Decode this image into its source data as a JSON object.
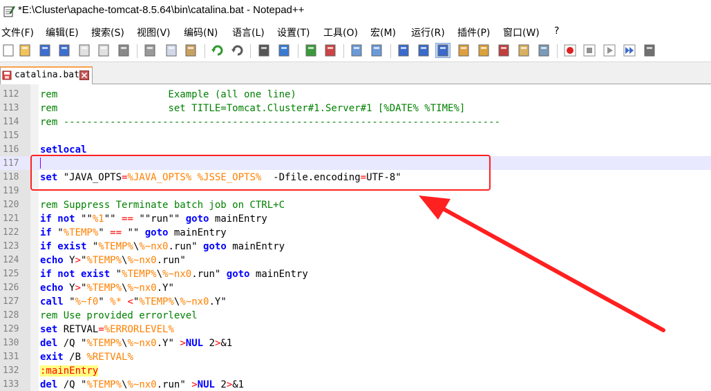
{
  "window": {
    "title": "*E:\\Cluster\\apache-tomcat-8.5.64\\bin\\catalina.bat - Notepad++",
    "app_icon": "notepad-icon"
  },
  "menu": [
    "文件(F)",
    "编辑(E)",
    "搜索(S)",
    "视图(V)",
    "编码(N)",
    "语言(L)",
    "设置(T)",
    "工具(O)",
    "宏(M)",
    "运行(R)",
    "插件(P)",
    "窗口(W)",
    "?"
  ],
  "toolbar": {
    "icons": [
      "new-file-icon",
      "open-file-icon",
      "save-icon",
      "save-all-icon",
      "close-icon",
      "close-all-icon",
      "print-icon",
      "cut-icon",
      "copy-icon",
      "paste-icon",
      "undo-icon",
      "redo-icon",
      "find-icon",
      "replace-icon",
      "zoom-in-icon",
      "zoom-out-icon",
      "sync-vertical-icon",
      "sync-horizontal-icon",
      "word-wrap-icon",
      "show-all-chars-icon",
      "indent-guide-icon",
      "udl-icon",
      "doc-map-icon",
      "function-list-icon",
      "folder-workspace-icon",
      "monitor-icon",
      "record-macro-icon",
      "stop-record-icon",
      "play-macro-icon",
      "run-macro-multiple-icon",
      "save-macro-icon"
    ],
    "active_icon": "indent-guide-icon"
  },
  "tab": {
    "label": "catalina.bat",
    "icon": "unsaved-file-icon",
    "close_icon": "tab-close-icon"
  },
  "editor": {
    "current_line": "117",
    "lines": [
      {
        "no": "112",
        "tokens": [
          [
            "cmt",
            "rem                   Example (all one line)"
          ]
        ]
      },
      {
        "no": "113",
        "tokens": [
          [
            "cmt",
            "rem                   set TITLE=Tomcat.Cluster#1.Server#1 [%DATE% %TIME%]"
          ]
        ]
      },
      {
        "no": "114",
        "tokens": [
          [
            "cmt",
            "rem ---------------------------------------------------------------------------"
          ]
        ]
      },
      {
        "no": "115",
        "tokens": []
      },
      {
        "no": "116",
        "tokens": [
          [
            "kw",
            "setlocal"
          ]
        ]
      },
      {
        "no": "117",
        "tokens": []
      },
      {
        "no": "118",
        "tokens": [
          [
            "kw",
            "set"
          ],
          [
            "txt",
            " \"JAVA_OPTS"
          ],
          [
            "op",
            "="
          ],
          [
            "var",
            "%JAVA_OPTS%"
          ],
          [
            "txt",
            " "
          ],
          [
            "var",
            "%JSSE_OPTS%"
          ],
          [
            "txt",
            "  -Dfile.encoding"
          ],
          [
            "op",
            "="
          ],
          [
            "txt",
            "UTF-8\""
          ]
        ]
      },
      {
        "no": "119",
        "tokens": []
      },
      {
        "no": "120",
        "tokens": [
          [
            "cmt",
            "rem Suppress Terminate batch job on CTRL+C"
          ]
        ]
      },
      {
        "no": "121",
        "tokens": [
          [
            "kw",
            "if not"
          ],
          [
            "txt",
            " \"\""
          ],
          [
            "var",
            "%1"
          ],
          [
            "txt",
            "\"\" "
          ],
          [
            "op",
            "=="
          ],
          [
            "txt",
            " \"\"run\"\" "
          ],
          [
            "kw",
            "goto"
          ],
          [
            "txt",
            " mainEntry"
          ]
        ]
      },
      {
        "no": "122",
        "tokens": [
          [
            "kw",
            "if"
          ],
          [
            "txt",
            " \""
          ],
          [
            "var",
            "%TEMP%"
          ],
          [
            "txt",
            "\" "
          ],
          [
            "op",
            "=="
          ],
          [
            "txt",
            " \"\" "
          ],
          [
            "kw",
            "goto"
          ],
          [
            "txt",
            " mainEntry"
          ]
        ]
      },
      {
        "no": "123",
        "tokens": [
          [
            "kw",
            "if exist"
          ],
          [
            "txt",
            " \""
          ],
          [
            "var",
            "%TEMP%"
          ],
          [
            "txt",
            "\\"
          ],
          [
            "var",
            "%~nx0"
          ],
          [
            "txt",
            ".run\" "
          ],
          [
            "kw",
            "goto"
          ],
          [
            "txt",
            " mainEntry"
          ]
        ]
      },
      {
        "no": "124",
        "tokens": [
          [
            "kw",
            "echo"
          ],
          [
            "txt",
            " Y"
          ],
          [
            "op",
            ">"
          ],
          [
            "txt",
            "\""
          ],
          [
            "var",
            "%TEMP%"
          ],
          [
            "txt",
            "\\"
          ],
          [
            "var",
            "%~nx0"
          ],
          [
            "txt",
            ".run\""
          ]
        ]
      },
      {
        "no": "125",
        "tokens": [
          [
            "kw",
            "if not exist"
          ],
          [
            "txt",
            " \""
          ],
          [
            "var",
            "%TEMP%"
          ],
          [
            "txt",
            "\\"
          ],
          [
            "var",
            "%~nx0"
          ],
          [
            "txt",
            ".run\" "
          ],
          [
            "kw",
            "goto"
          ],
          [
            "txt",
            " mainEntry"
          ]
        ]
      },
      {
        "no": "126",
        "tokens": [
          [
            "kw",
            "echo"
          ],
          [
            "txt",
            " Y"
          ],
          [
            "op",
            ">"
          ],
          [
            "txt",
            "\""
          ],
          [
            "var",
            "%TEMP%"
          ],
          [
            "txt",
            "\\"
          ],
          [
            "var",
            "%~nx0"
          ],
          [
            "txt",
            ".Y\""
          ]
        ]
      },
      {
        "no": "127",
        "tokens": [
          [
            "kw",
            "call"
          ],
          [
            "txt",
            " \""
          ],
          [
            "var",
            "%~f0"
          ],
          [
            "txt",
            "\" "
          ],
          [
            "var",
            "%*"
          ],
          [
            "txt",
            " "
          ],
          [
            "op",
            "<"
          ],
          [
            "txt",
            "\""
          ],
          [
            "var",
            "%TEMP%"
          ],
          [
            "txt",
            "\\"
          ],
          [
            "var",
            "%~nx0"
          ],
          [
            "txt",
            ".Y\""
          ]
        ]
      },
      {
        "no": "128",
        "tokens": [
          [
            "cmt",
            "rem Use provided errorlevel"
          ]
        ]
      },
      {
        "no": "129",
        "tokens": [
          [
            "kw",
            "set"
          ],
          [
            "txt",
            " RETVAL"
          ],
          [
            "op",
            "="
          ],
          [
            "var",
            "%ERRORLEVEL%"
          ]
        ]
      },
      {
        "no": "130",
        "tokens": [
          [
            "kw",
            "del"
          ],
          [
            "txt",
            " /Q \""
          ],
          [
            "var",
            "%TEMP%"
          ],
          [
            "txt",
            "\\"
          ],
          [
            "var",
            "%~nx0"
          ],
          [
            "txt",
            ".Y\" "
          ],
          [
            "op",
            ">"
          ],
          [
            "kw",
            "NUL"
          ],
          [
            "txt",
            " 2"
          ],
          [
            "op",
            ">"
          ],
          [
            "txt",
            "&1"
          ]
        ]
      },
      {
        "no": "131",
        "tokens": [
          [
            "kw",
            "exit"
          ],
          [
            "txt",
            " /B "
          ],
          [
            "var",
            "%RETVAL%"
          ]
        ]
      },
      {
        "no": "132",
        "tokens": [
          [
            "lbl",
            ":mainEntry"
          ]
        ]
      },
      {
        "no": "133",
        "tokens": [
          [
            "kw",
            "del"
          ],
          [
            "txt",
            " /Q \""
          ],
          [
            "var",
            "%TEMP%"
          ],
          [
            "txt",
            "\\"
          ],
          [
            "var",
            "%~nx0"
          ],
          [
            "txt",
            ".run\" "
          ],
          [
            "op",
            ">"
          ],
          [
            "kw",
            "NUL"
          ],
          [
            "txt",
            " 2"
          ],
          [
            "op",
            ">"
          ],
          [
            "txt",
            "&1"
          ]
        ]
      }
    ]
  },
  "annotation": {
    "highlighted_line": "118",
    "color": "#ff2020"
  },
  "colors": {
    "keyword": "#0000ff",
    "comment": "#008000",
    "variable": "#ff8000",
    "operator": "#ff0000",
    "label_bg": "#ffff80",
    "current_line": "#e8e8ff",
    "tab_accent": "#f9a04b"
  }
}
